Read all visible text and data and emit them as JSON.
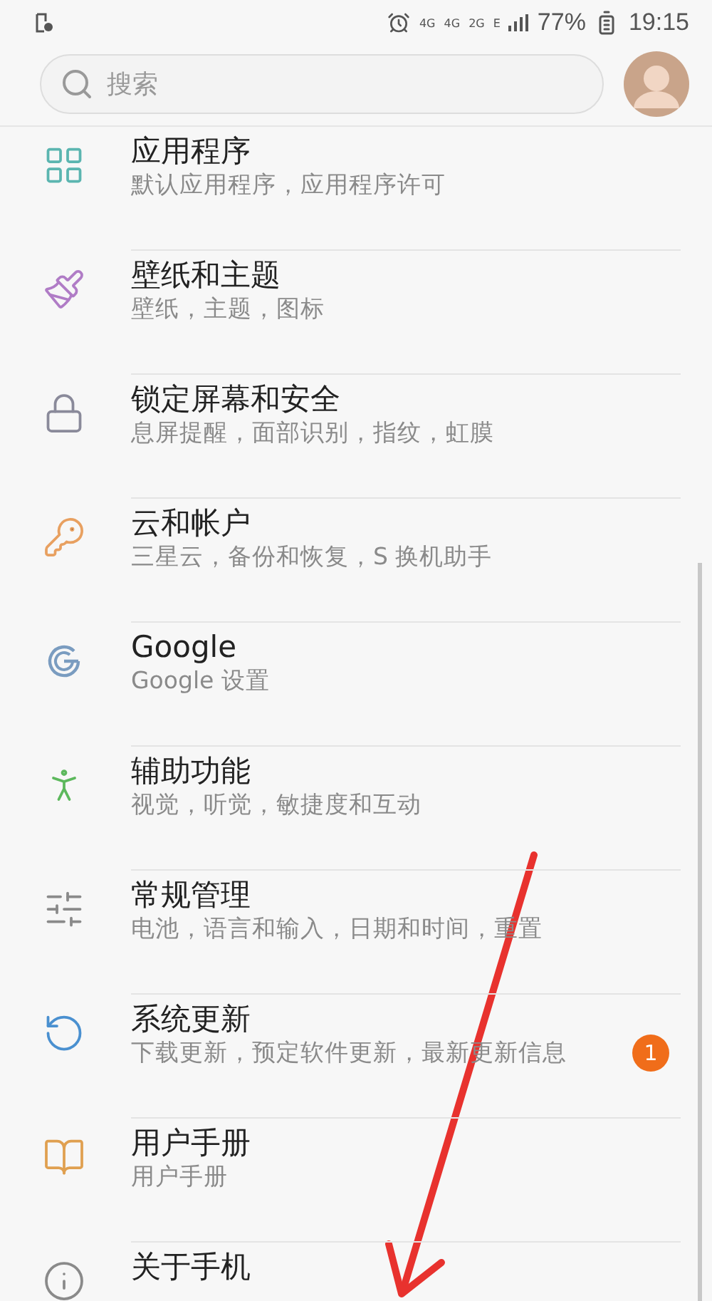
{
  "status_bar": {
    "network_labels": [
      "4G",
      "4G",
      "2G",
      "E"
    ],
    "battery": "77%",
    "time": "19:15"
  },
  "search": {
    "placeholder": "搜索"
  },
  "settings": [
    {
      "title": "应用程序",
      "subtitle": "默认应用程序，应用程序许可"
    },
    {
      "title": "壁纸和主题",
      "subtitle": "壁纸，主题，图标"
    },
    {
      "title": "锁定屏幕和安全",
      "subtitle": "息屏提醒，面部识别，指纹，虹膜"
    },
    {
      "title": "云和帐户",
      "subtitle": "三星云，备份和恢复，S 换机助手"
    },
    {
      "title": "Google",
      "subtitle": "Google 设置"
    },
    {
      "title": "辅助功能",
      "subtitle": "视觉，听觉，敏捷度和互动"
    },
    {
      "title": "常规管理",
      "subtitle": "电池，语言和输入，日期和时间，重置"
    },
    {
      "title": "系统更新",
      "subtitle": "下载更新，预定软件更新，最新更新信息",
      "badge": "1"
    },
    {
      "title": "用户手册",
      "subtitle": "用户手册"
    },
    {
      "title": "关于手机"
    }
  ]
}
